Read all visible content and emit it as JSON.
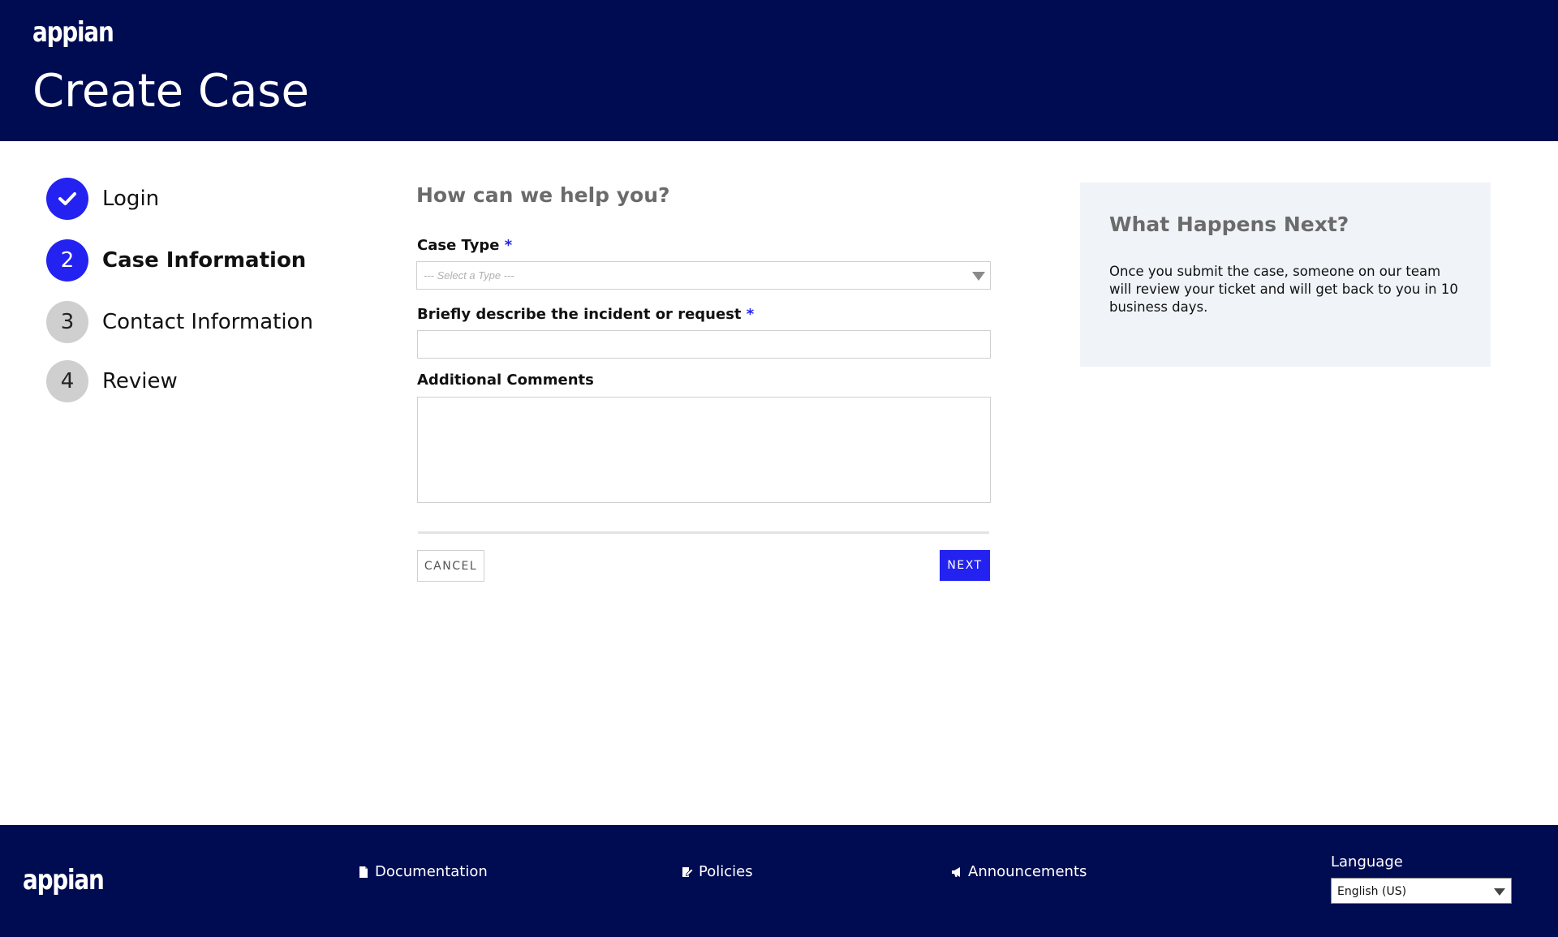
{
  "header": {
    "logo_text": "appian",
    "page_title": "Create Case"
  },
  "steps": [
    {
      "number": "",
      "label": "Login",
      "state": "done",
      "icon": "check-icon"
    },
    {
      "number": "2",
      "label": "Case Information",
      "state": "active"
    },
    {
      "number": "3",
      "label": "Contact Information",
      "state": "pending"
    },
    {
      "number": "4",
      "label": "Review",
      "state": "pending"
    }
  ],
  "form": {
    "section_title": "How can we help you?",
    "case_type": {
      "label": "Case Type",
      "required_marker": "*",
      "placeholder": "--- Select a Type ---"
    },
    "description": {
      "label": "Briefly describe the incident or request",
      "required_marker": "*",
      "value": ""
    },
    "comments": {
      "label": "Additional Comments",
      "value": ""
    },
    "cancel_label": "CANCEL",
    "next_label": "NEXT"
  },
  "info_panel": {
    "title": "What Happens Next?",
    "text": "Once you submit the case, someone on our team will review your ticket and will get back to you in 10 business days."
  },
  "footer": {
    "logo_text": "appian",
    "links": [
      {
        "label": "Documentation",
        "icon": "document-icon"
      },
      {
        "label": "Policies",
        "icon": "edit-document-icon"
      },
      {
        "label": "Announcements",
        "icon": "megaphone-icon"
      }
    ],
    "language_label": "Language",
    "language_value": "English (US)"
  },
  "colors": {
    "navy": "#000c52",
    "accent_blue": "#2322f0",
    "pending_gray": "#cfcfcf",
    "panel_bg": "#f0f3f7"
  }
}
